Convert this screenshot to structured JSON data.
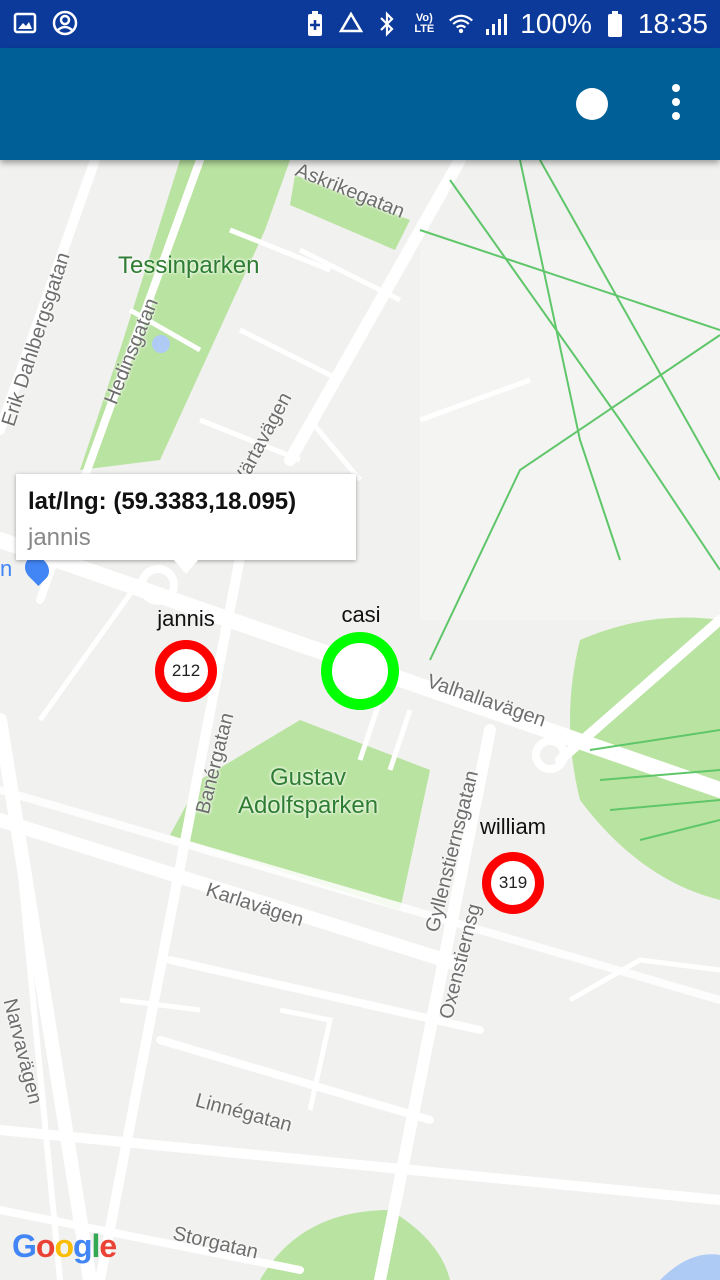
{
  "status_bar": {
    "battery": "100%",
    "time": "18:35",
    "lte_label": "Vo) LTE",
    "icons": [
      "image-icon",
      "account-circle-icon",
      "battery-saver-icon",
      "data-saver-icon",
      "bluetooth-icon",
      "volte-icon",
      "wifi-icon",
      "signal-icon",
      "battery-icon"
    ]
  },
  "app_bar": {
    "background": "#005f96",
    "icons": [
      "status-dot-icon",
      "overflow-menu-icon"
    ]
  },
  "info_window": {
    "title": "lat/lng: (59.3383,18.095)",
    "snippet": "jannis"
  },
  "markers": [
    {
      "name": "jannis",
      "value": "212",
      "ring_color": "#ff0000"
    },
    {
      "name": "casi",
      "value": "",
      "ring_color": "#00ff00"
    },
    {
      "name": "william",
      "value": "319",
      "ring_color": "#ff0000"
    }
  ],
  "parks": {
    "tessinparken": "Tessinparken",
    "gustav": "Gustav",
    "adolfsparken": "Adolfsparken"
  },
  "streets": {
    "askrikegatan": "Askrikegatan",
    "erik_dahlbergsgatan": "Erik Dahlbergsgatan",
    "hedinsgatan": "Hedinsgatan",
    "vartavagen": "Värtavägen",
    "valhallavagen": "Valhallavägen",
    "banergatan": "Banérgatan",
    "gyllenstiernsgatan": "Gyllenstiernsgatan",
    "karlavagen": "Karlavägen",
    "oxenstiernsgatan": "Oxenstiernsg",
    "narvavagen": "Narvavägen",
    "linnegatan": "Linnégatan",
    "storgatan": "Storgatan"
  },
  "poi": {
    "partial_label": "n"
  },
  "attribution": {
    "logo": "Google",
    "colors": [
      "#4285f4",
      "#ea4335",
      "#fbbc05",
      "#4285f4",
      "#34a853",
      "#ea4335"
    ]
  }
}
